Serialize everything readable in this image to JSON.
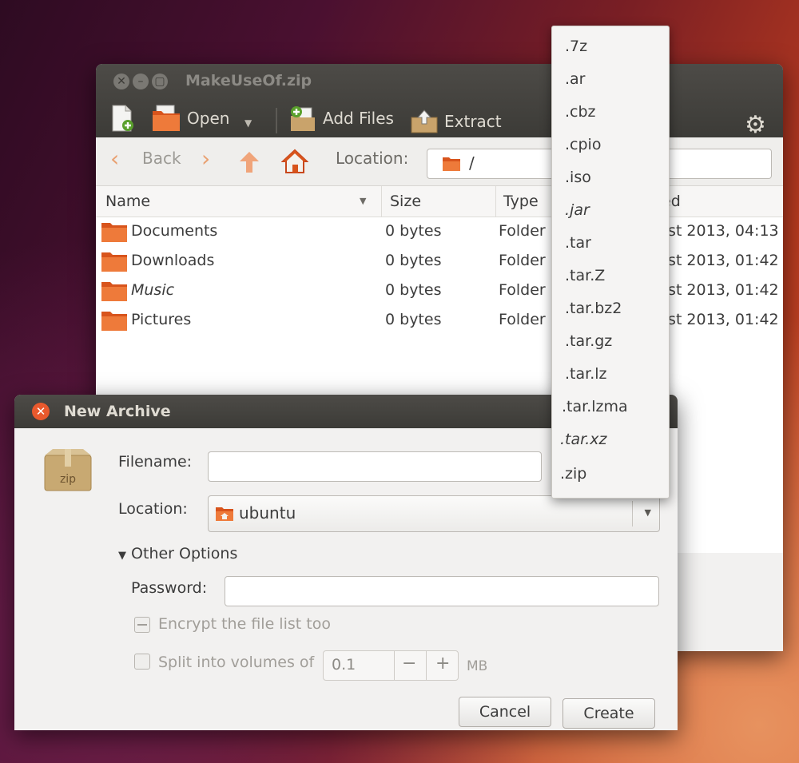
{
  "main_window": {
    "title": "MakeUseOf.zip",
    "toolbar": {
      "open_label": "Open",
      "add_files_label": "Add Files",
      "extract_label": "Extract"
    },
    "nav": {
      "back_label": "Back",
      "location_label": "Location:",
      "location_value": "/"
    },
    "columns": {
      "name": "Name",
      "size": "Size",
      "type": "Type",
      "modified": "ed"
    },
    "rows": [
      {
        "name": "Documents",
        "size": "0 bytes",
        "type": "Folder",
        "modified": "ust 2013, 04:13"
      },
      {
        "name": "Downloads",
        "size": "0 bytes",
        "type": "Folder",
        "modified": "ust 2013, 01:42"
      },
      {
        "name": "Music",
        "size": "0 bytes",
        "type": "Folder",
        "modified": "ust 2013, 01:42"
      },
      {
        "name": "Pictures",
        "size": "0 bytes",
        "type": "Folder",
        "modified": "ust 2013, 01:42"
      }
    ]
  },
  "extension_menu": {
    "items": [
      ".7z",
      ".ar",
      ".cbz",
      ".cpio",
      ".iso",
      ".jar",
      ".tar",
      ".tar.Z",
      ".tar.bz2",
      ".tar.gz",
      ".tar.lz",
      ".tar.lzma",
      ".tar.xz",
      ".zip"
    ]
  },
  "dialog": {
    "title": "New Archive",
    "icon_text": "zip",
    "filename_label": "Filename:",
    "filename_value": "",
    "location_label": "Location:",
    "location_value": "ubuntu",
    "other_options_label": "Other Options",
    "password_label": "Password:",
    "password_value": "",
    "encrypt_label": "Encrypt the file list too",
    "split_label": "Split into volumes of",
    "split_value": "0.1",
    "split_unit": "MB",
    "cancel_label": "Cancel",
    "create_label": "Create"
  },
  "colors": {
    "titlebar": "#3c3b37",
    "close_button": "#e9592d",
    "folder": "#e8662a"
  }
}
